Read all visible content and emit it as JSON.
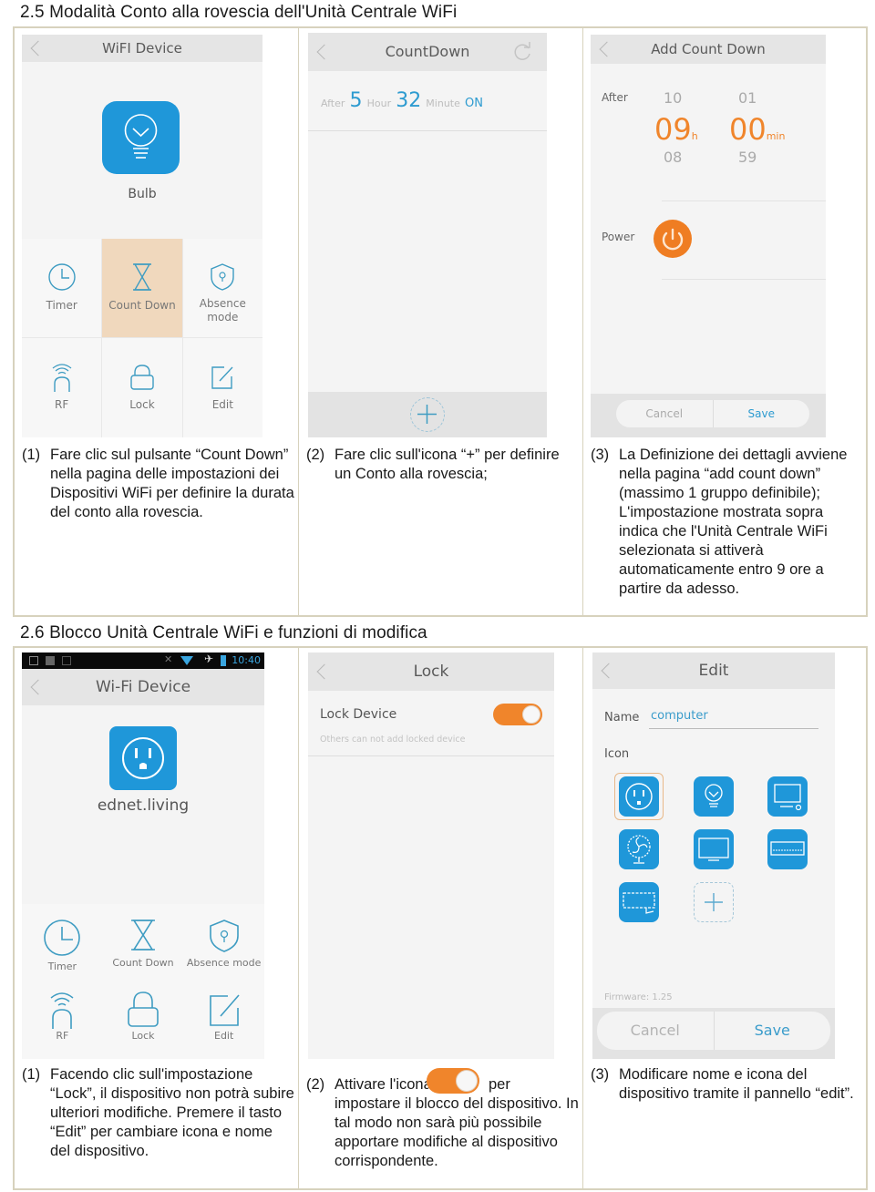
{
  "sections": [
    {
      "title": "2.5  Modalità Conto alla rovescia dell'Unità Centrale WiFi",
      "panels": {
        "device": {
          "nav_title": "WiFI Device",
          "device_name": "Bulb",
          "device_icon": "bulb-icon",
          "functions": [
            {
              "label": "Timer",
              "icon": "clock-icon",
              "selected": false
            },
            {
              "label": "Count Down",
              "icon": "hourglass-icon",
              "selected": true
            },
            {
              "label": "Absence mode",
              "icon": "shield-icon",
              "selected": false
            },
            {
              "label": "RF",
              "icon": "rf-signal-icon",
              "selected": false
            },
            {
              "label": "Lock",
              "icon": "lock-icon",
              "selected": false
            },
            {
              "label": "Edit",
              "icon": "edit-icon",
              "selected": false
            }
          ],
          "absence_line1": "Absence",
          "absence_line2": "mode"
        },
        "countdown": {
          "nav_title": "CountDown",
          "entry": {
            "after_label": "After",
            "hours": "5",
            "hour_label": "Hour",
            "minutes": "32",
            "minute_label": "Minute",
            "state": "ON"
          }
        },
        "add_countdown": {
          "nav_title": "Add Count Down",
          "after_label": "After",
          "hours": {
            "prev": "10",
            "current": "09",
            "next": "08",
            "unit": "h"
          },
          "minutes": {
            "prev": "01",
            "current": "00",
            "next": "59",
            "unit": "min"
          },
          "power_label": "Power",
          "cancel_label": "Cancel",
          "save_label": "Save"
        }
      },
      "captions": [
        {
          "num": "(1)",
          "text": "Fare clic sul pulsante “Count Down” nella pagina delle impostazioni dei Dispositivi WiFi per definire la durata del conto alla rovescia."
        },
        {
          "num": "(2)",
          "text": "Fare clic sull'icona “+” per definire un Conto alla rovescia;"
        },
        {
          "num": "(3)",
          "text_lines": [
            "La Definizione dei dettagli avviene nella pagina “add count down” (massimo 1 gruppo definibile);",
            "L'impostazione mostrata sopra indica che l'Unità Centrale WiFi selezionata si attiverà automaticamente entro 9 ore a partire da adesso."
          ]
        }
      ]
    },
    {
      "title": "2.6  Blocco Unità Centrale WiFi e funzioni di modifica",
      "panels": {
        "device": {
          "status_time": "10:40",
          "nav_title": "Wi-Fi Device",
          "device_name": "ednet.living",
          "device_icon": "power-socket-icon",
          "functions": [
            {
              "label": "Timer",
              "icon": "clock-icon"
            },
            {
              "label": "Count Down",
              "icon": "hourglass-icon"
            },
            {
              "label": "Absence mode",
              "icon": "shield-icon"
            },
            {
              "label": "RF",
              "icon": "rf-signal-icon"
            },
            {
              "label": "Lock",
              "icon": "lock-icon"
            },
            {
              "label": "Edit",
              "icon": "edit-icon"
            }
          ]
        },
        "lock": {
          "nav_title": "Lock",
          "lock_label": "Lock Device",
          "lock_enabled": true,
          "lock_hint": "Others can not add locked device"
        },
        "edit": {
          "nav_title": "Edit",
          "name_label": "Name",
          "name_value": "computer",
          "icon_label": "Icon",
          "icons": [
            "power-socket-icon",
            "bulb-icon",
            "computer-icon",
            "fan-icon",
            "tv-icon",
            "air-conditioner-icon",
            "heater-icon",
            "add-icon"
          ],
          "selected_icon": "power-socket-icon",
          "firmware": "Firmware: 1.25",
          "cancel_label": "Cancel",
          "save_label": "Save"
        }
      },
      "captions": [
        {
          "num": "(1)",
          "text": "Facendo clic sull'impostazione “Lock”, il dispositivo non potrà subire ulteriori modifiche. Premere il tasto “Edit” per cambiare icona e nome del dispositivo."
        },
        {
          "num": "(2)",
          "before": "Attivare l'icona",
          "after": "per",
          "text": "impostare il blocco del dispositivo. In tal modo non sarà più possibile apportare modifiche al dispositivo corrispondente."
        },
        {
          "num": "(3)",
          "text": "Modificare nome e icona del dispositivo tramite il pannello “edit”."
        }
      ]
    }
  ],
  "colors": {
    "accent_blue": "#1f97d9",
    "accent_orange": "#f0852b",
    "selected_cell": "#f0d8bd",
    "frame_border": "#d7d2bd"
  }
}
